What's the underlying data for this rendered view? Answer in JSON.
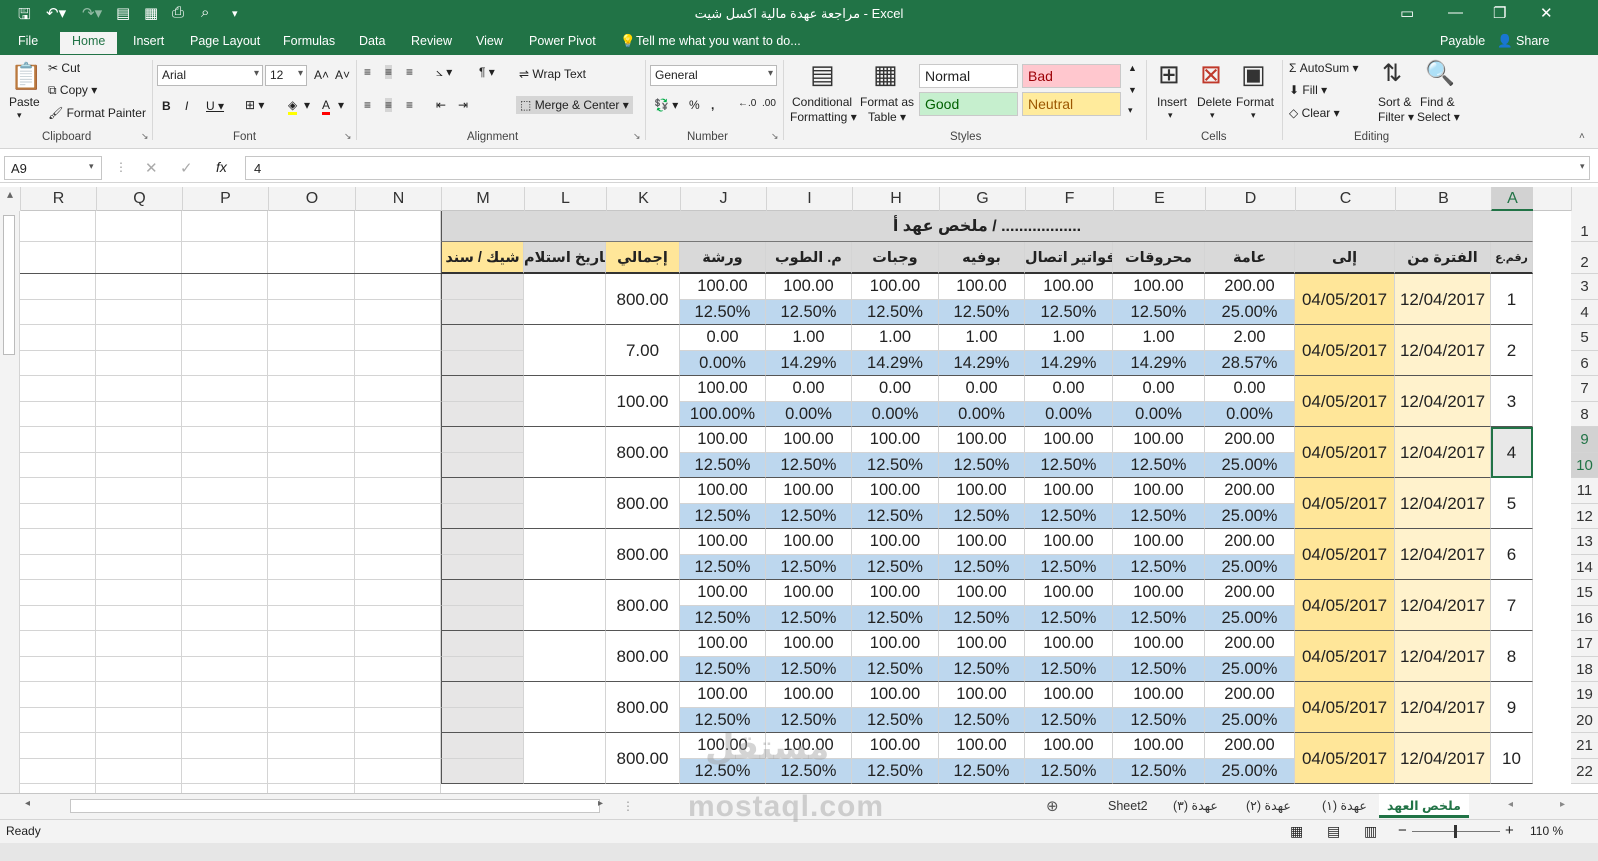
{
  "window": {
    "title": "مراجعة عهدة مالية اكسل شيت - Excel"
  },
  "tabs": [
    "File",
    "Home",
    "Insert",
    "Page Layout",
    "Formulas",
    "Data",
    "Review",
    "View",
    "Power Pivot"
  ],
  "active_tab": "Home",
  "tellme": "Tell me what you want to do...",
  "account": {
    "user": "Payable",
    "share": "Share"
  },
  "ribbon": {
    "clipboard": {
      "paste": "Paste",
      "cut": "Cut",
      "copy": "Copy",
      "format_painter": "Format Painter",
      "label": "Clipboard"
    },
    "font": {
      "name": "Arial",
      "size": "12",
      "label": "Font"
    },
    "alignment": {
      "wrap": "Wrap Text",
      "merge": "Merge & Center",
      "label": "Alignment"
    },
    "number": {
      "format": "General",
      "label": "Number"
    },
    "styles": {
      "conditional": "Conditional",
      "conditional2": "Formatting",
      "format_table": "Format as",
      "format_table2": "Table",
      "normal": "Normal",
      "bad": "Bad",
      "good": "Good",
      "neutral": "Neutral",
      "label": "Styles"
    },
    "cells": {
      "insert": "Insert",
      "delete": "Delete",
      "format": "Format",
      "label": "Cells"
    },
    "editing": {
      "autosum": "AutoSum",
      "fill": "Fill",
      "clear": "Clear",
      "sort": "Sort &",
      "sort2": "Filter",
      "find": "Find &",
      "find2": "Select",
      "label": "Editing"
    }
  },
  "namebox": "A9",
  "formula": "4",
  "columns": [
    "R",
    "Q",
    "P",
    "O",
    "N",
    "M",
    "L",
    "K",
    "J",
    "I",
    "H",
    "G",
    "F",
    "E",
    "D",
    "C",
    "B",
    "A"
  ],
  "sheet_title": "ملخص عهد أ / ..................",
  "headers": {
    "A": "رقم.ع",
    "B": "الفترة من",
    "C": "إلى",
    "D": "عامة",
    "E": "محروقات",
    "F": "فواتير اتصال",
    "G": "بوفيه",
    "H": "وجبات",
    "I": "م. الطوب",
    "J": "ورشة",
    "K": "إجمالي",
    "L": "تاريخ استلام",
    "M": "شيك / سند"
  },
  "rows": [
    {
      "n": "1",
      "from": "12/04/2017",
      "to": "04/05/2017",
      "v": [
        "200.00",
        "100.00",
        "100.00",
        "100.00",
        "100.00",
        "100.00",
        "100.00"
      ],
      "p": [
        "25.00%",
        "12.50%",
        "12.50%",
        "12.50%",
        "12.50%",
        "12.50%",
        "12.50%"
      ],
      "total": "800.00"
    },
    {
      "n": "2",
      "from": "12/04/2017",
      "to": "04/05/2017",
      "v": [
        "2.00",
        "1.00",
        "1.00",
        "1.00",
        "1.00",
        "1.00",
        "0.00"
      ],
      "p": [
        "28.57%",
        "14.29%",
        "14.29%",
        "14.29%",
        "14.29%",
        "14.29%",
        "0.00%"
      ],
      "total": "7.00"
    },
    {
      "n": "3",
      "from": "12/04/2017",
      "to": "04/05/2017",
      "v": [
        "0.00",
        "0.00",
        "0.00",
        "0.00",
        "0.00",
        "0.00",
        "100.00"
      ],
      "p": [
        "0.00%",
        "0.00%",
        "0.00%",
        "0.00%",
        "0.00%",
        "0.00%",
        "100.00%"
      ],
      "total": "100.00"
    },
    {
      "n": "4",
      "from": "12/04/2017",
      "to": "04/05/2017",
      "v": [
        "200.00",
        "100.00",
        "100.00",
        "100.00",
        "100.00",
        "100.00",
        "100.00"
      ],
      "p": [
        "25.00%",
        "12.50%",
        "12.50%",
        "12.50%",
        "12.50%",
        "12.50%",
        "12.50%"
      ],
      "total": "800.00"
    },
    {
      "n": "5",
      "from": "12/04/2017",
      "to": "04/05/2017",
      "v": [
        "200.00",
        "100.00",
        "100.00",
        "100.00",
        "100.00",
        "100.00",
        "100.00"
      ],
      "p": [
        "25.00%",
        "12.50%",
        "12.50%",
        "12.50%",
        "12.50%",
        "12.50%",
        "12.50%"
      ],
      "total": "800.00"
    },
    {
      "n": "6",
      "from": "12/04/2017",
      "to": "04/05/2017",
      "v": [
        "200.00",
        "100.00",
        "100.00",
        "100.00",
        "100.00",
        "100.00",
        "100.00"
      ],
      "p": [
        "25.00%",
        "12.50%",
        "12.50%",
        "12.50%",
        "12.50%",
        "12.50%",
        "12.50%"
      ],
      "total": "800.00"
    },
    {
      "n": "7",
      "from": "12/04/2017",
      "to": "04/05/2017",
      "v": [
        "200.00",
        "100.00",
        "100.00",
        "100.00",
        "100.00",
        "100.00",
        "100.00"
      ],
      "p": [
        "25.00%",
        "12.50%",
        "12.50%",
        "12.50%",
        "12.50%",
        "12.50%",
        "12.50%"
      ],
      "total": "800.00"
    },
    {
      "n": "8",
      "from": "12/04/2017",
      "to": "04/05/2017",
      "v": [
        "200.00",
        "100.00",
        "100.00",
        "100.00",
        "100.00",
        "100.00",
        "100.00"
      ],
      "p": [
        "25.00%",
        "12.50%",
        "12.50%",
        "12.50%",
        "12.50%",
        "12.50%",
        "12.50%"
      ],
      "total": "800.00"
    },
    {
      "n": "9",
      "from": "12/04/2017",
      "to": "04/05/2017",
      "v": [
        "200.00",
        "100.00",
        "100.00",
        "100.00",
        "100.00",
        "100.00",
        "100.00"
      ],
      "p": [
        "25.00%",
        "12.50%",
        "12.50%",
        "12.50%",
        "12.50%",
        "12.50%",
        "12.50%"
      ],
      "total": "800.00"
    },
    {
      "n": "10",
      "from": "12/04/2017",
      "to": "04/05/2017",
      "v": [
        "200.00",
        "100.00",
        "100.00",
        "100.00",
        "100.00",
        "100.00",
        "100.00"
      ],
      "p": [
        "25.00%",
        "12.50%",
        "12.50%",
        "12.50%",
        "12.50%",
        "12.50%",
        "12.50%"
      ],
      "total": "800.00"
    }
  ],
  "row_numbers": [
    "1",
    "2",
    "3",
    "4",
    "5",
    "6",
    "7",
    "8",
    "9",
    "10",
    "11",
    "12",
    "13",
    "14",
    "15",
    "16",
    "17",
    "18",
    "19",
    "20",
    "21",
    "22"
  ],
  "sheets": [
    "ملخص العهد",
    "عهدة (١)",
    "عهدة (٢)",
    "عهدة (٣)",
    "Sheet2"
  ],
  "active_sheet": "ملخص العهد",
  "status": {
    "ready": "Ready",
    "zoom": "110 %"
  },
  "watermark": {
    "logo": "مستقل",
    "url": "mostaql.com"
  },
  "colors": {
    "green": "#217346",
    "blue": "#bdd7ee",
    "yellow": "#ffe699",
    "header_gray": "#d9d9d9",
    "bad": "#ffc7ce",
    "good": "#c6efce",
    "neutral": "#ffeb9c"
  }
}
